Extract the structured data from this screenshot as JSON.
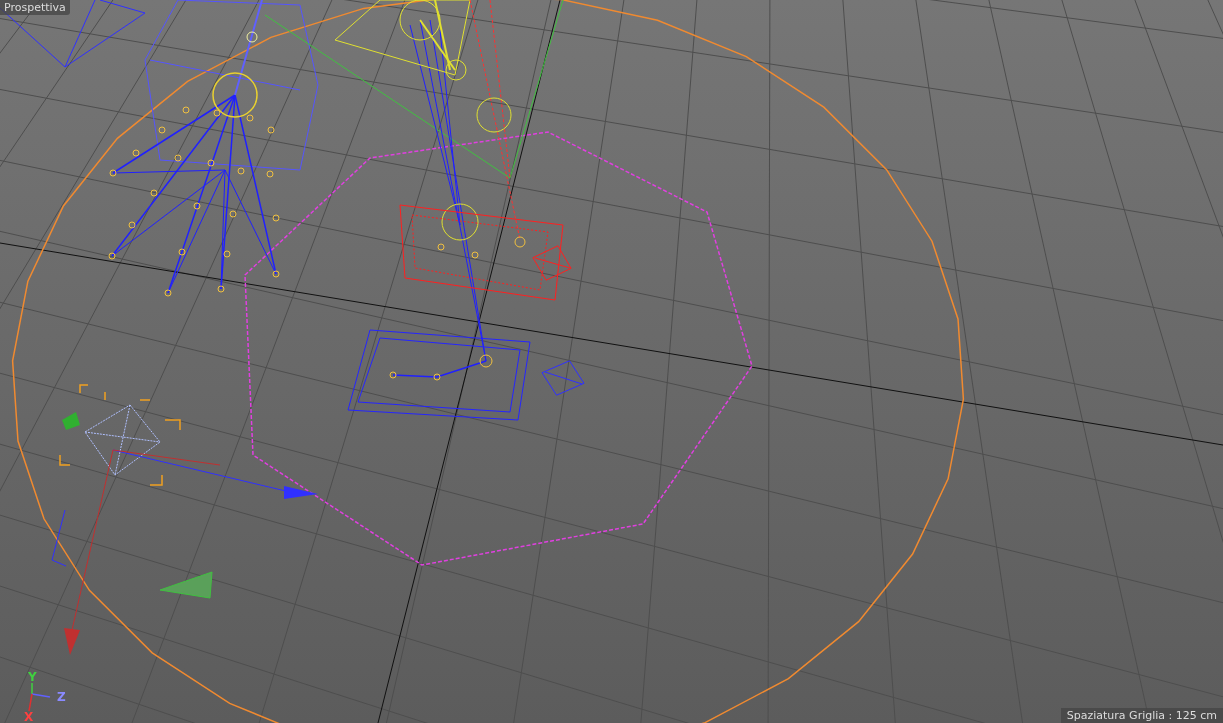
{
  "viewport": {
    "title": "Prospettiva",
    "status": "Spaziatura Griglia : 125 cm"
  },
  "axis_gizmo": {
    "labels": [
      {
        "text": "Y",
        "kind": "y"
      },
      {
        "text": "Z",
        "kind": "z"
      },
      {
        "text": "X",
        "kind": "x"
      }
    ]
  }
}
